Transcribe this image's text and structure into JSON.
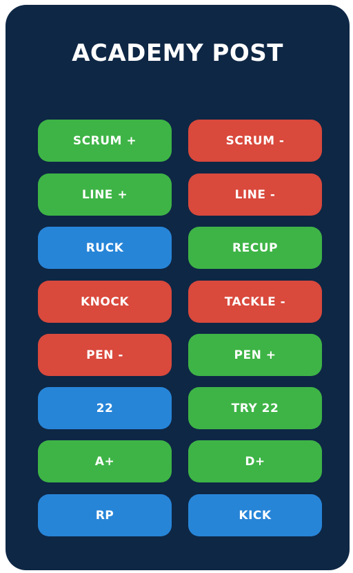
{
  "title": "ACADEMY POST",
  "colors": {
    "panel_bg": "#0e2745",
    "green": "#3eb446",
    "red": "#d9493c",
    "blue": "#2785d8",
    "text": "#ffffff"
  },
  "buttons": [
    {
      "label": "SCRUM +",
      "color": "green"
    },
    {
      "label": "SCRUM -",
      "color": "red"
    },
    {
      "label": "LINE +",
      "color": "green"
    },
    {
      "label": "LINE -",
      "color": "red"
    },
    {
      "label": "RUCK",
      "color": "blue"
    },
    {
      "label": "RECUP",
      "color": "green"
    },
    {
      "label": "KNOCK",
      "color": "red"
    },
    {
      "label": "TACKLE -",
      "color": "red"
    },
    {
      "label": "PEN -",
      "color": "red"
    },
    {
      "label": "PEN +",
      "color": "green"
    },
    {
      "label": "22",
      "color": "blue"
    },
    {
      "label": "TRY 22",
      "color": "green"
    },
    {
      "label": "A+",
      "color": "green"
    },
    {
      "label": "D+",
      "color": "green"
    },
    {
      "label": "RP",
      "color": "blue"
    },
    {
      "label": "KICK",
      "color": "blue"
    }
  ]
}
